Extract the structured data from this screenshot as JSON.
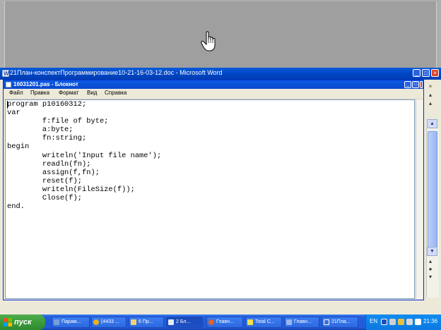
{
  "word": {
    "title": "21План-конспектПрограммирование10-21-16-03-12.doc - Microsoft Word"
  },
  "notepad": {
    "title": "16031201.pas - Блокнот",
    "menu": [
      "Файл",
      "Правка",
      "Формат",
      "Вид",
      "Справка"
    ],
    "code": "program p10160312;\nvar\n        f:file of byte;\n        a:byte;\n        fn:string;\nbegin\n        writeln('Input file name');\n        readln(fn);\n        assign(f,fn);\n        reset(f);\n        writeln(FileSize(f));\n        Close(f);\nend."
  },
  "window_controls": {
    "minimize": "_",
    "maximize": "□",
    "close": "×"
  },
  "taskbar": {
    "start_label": "пуск",
    "buttons": [
      {
        "label": "Парам...",
        "icon": "gear-icon"
      },
      {
        "label": "(4433 ...",
        "icon": "chrome-icon"
      },
      {
        "label": "6 Пр...",
        "icon": "folder-icon"
      },
      {
        "label": "2 Бл...",
        "icon": "notepad-icon"
      },
      {
        "label": "Главн...",
        "icon": "firefox-icon"
      },
      {
        "label": "Total C...",
        "icon": "totalcmd-icon"
      },
      {
        "label": "Главн...",
        "icon": "window-icon"
      },
      {
        "label": "21Пла...",
        "icon": "word-icon"
      }
    ],
    "tray": {
      "language": "EN",
      "clock": "21:36"
    }
  },
  "colors": {
    "xp_blue": "#0047c7",
    "taskbar": "#245edc",
    "start_green": "#3b9b3b",
    "gray_bg": "#9f9f9f"
  }
}
